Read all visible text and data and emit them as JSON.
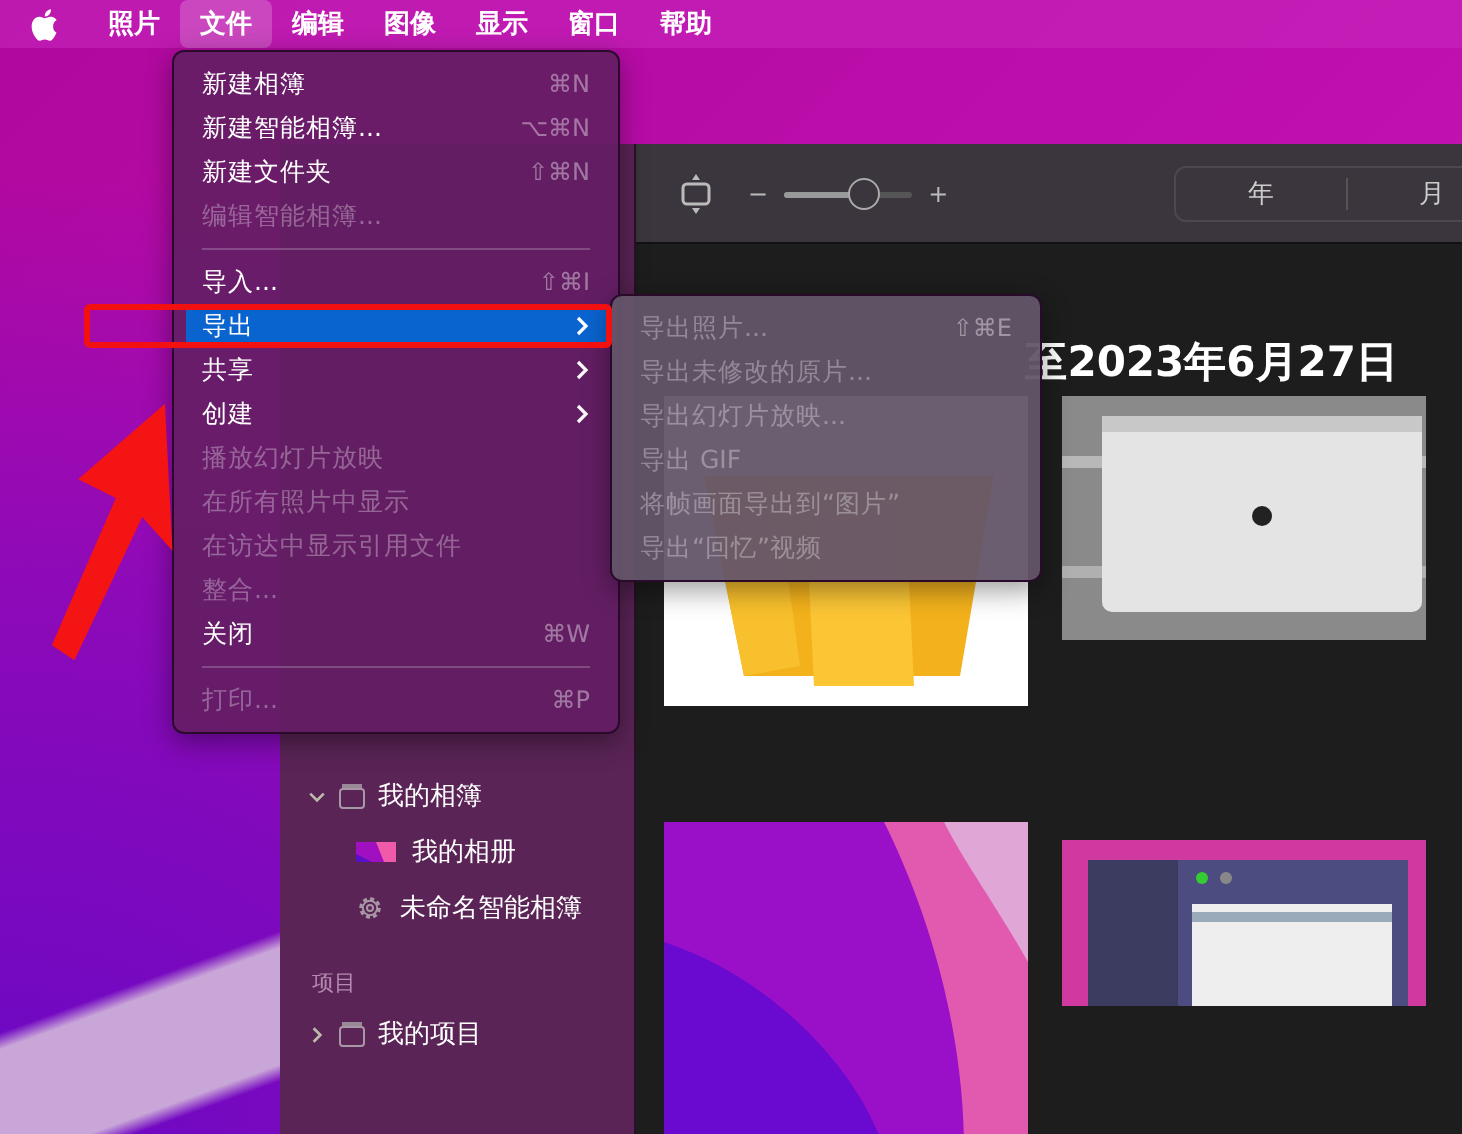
{
  "menu_bar": {
    "items": [
      {
        "label": "照片",
        "selected": false
      },
      {
        "label": "文件",
        "selected": true
      },
      {
        "label": "编辑",
        "selected": false
      },
      {
        "label": "图像",
        "selected": false
      },
      {
        "label": "显示",
        "selected": false
      },
      {
        "label": "窗口",
        "selected": false
      },
      {
        "label": "帮助",
        "selected": false
      }
    ]
  },
  "file_menu": {
    "items": [
      {
        "kind": "item",
        "label": "新建相簿",
        "shortcut": "⌘N",
        "disabled": false,
        "submenu": false,
        "selected": false
      },
      {
        "kind": "item",
        "label": "新建智能相簿...",
        "shortcut": "⌥⌘N",
        "disabled": false,
        "submenu": false,
        "selected": false
      },
      {
        "kind": "item",
        "label": "新建文件夹",
        "shortcut": "⇧⌘N",
        "disabled": false,
        "submenu": false,
        "selected": false
      },
      {
        "kind": "item",
        "label": "编辑智能相簿...",
        "disabled": true,
        "submenu": false,
        "selected": false
      },
      {
        "kind": "separator"
      },
      {
        "kind": "item",
        "label": "导入...",
        "shortcut": "⇧⌘I",
        "disabled": false,
        "submenu": false,
        "selected": false
      },
      {
        "kind": "item",
        "label": "导出",
        "disabled": false,
        "submenu": true,
        "selected": true
      },
      {
        "kind": "item",
        "label": "共享",
        "disabled": false,
        "submenu": true,
        "selected": false
      },
      {
        "kind": "item",
        "label": "创建",
        "disabled": false,
        "submenu": true,
        "selected": false
      },
      {
        "kind": "item",
        "label": "播放幻灯片放映",
        "disabled": true,
        "submenu": false,
        "selected": false
      },
      {
        "kind": "item",
        "label": "在所有照片中显示",
        "disabled": true,
        "submenu": false,
        "selected": false
      },
      {
        "kind": "item",
        "label": "在访达中显示引用文件",
        "disabled": true,
        "submenu": false,
        "selected": false
      },
      {
        "kind": "item",
        "label": "整合...",
        "disabled": true,
        "submenu": false,
        "selected": false
      },
      {
        "kind": "item",
        "label": "关闭",
        "shortcut": "⌘W",
        "disabled": false,
        "submenu": false,
        "selected": false
      },
      {
        "kind": "separator"
      },
      {
        "kind": "item",
        "label": "打印...",
        "shortcut": "⌘P",
        "disabled": true,
        "submenu": false,
        "selected": false
      }
    ]
  },
  "export_submenu": {
    "items": [
      {
        "label": "导出照片...",
        "shortcut": "⇧⌘E",
        "disabled": true
      },
      {
        "label": "导出未修改的原片...",
        "disabled": true
      },
      {
        "label": "导出幻灯片放映...",
        "disabled": true
      },
      {
        "label": "导出 GIF",
        "disabled": true
      },
      {
        "label": "将帧画面导出到“图片”",
        "disabled": true
      },
      {
        "label": "导出“回忆”视频",
        "disabled": true
      }
    ]
  },
  "sidebar": {
    "items": [
      {
        "kind": "folder",
        "label": "我的相簿",
        "expanded": true,
        "children": [
          {
            "kind": "album",
            "label": "我的相册"
          },
          {
            "kind": "smart",
            "label": "未命名智能相簿"
          }
        ]
      },
      {
        "kind": "header",
        "label": "项目"
      },
      {
        "kind": "folder",
        "label": "我的项目",
        "expanded": false
      }
    ]
  },
  "toolbar": {
    "zoom": {
      "minus": "−",
      "plus": "+",
      "level": 0.63
    },
    "segments": [
      {
        "label": "年"
      },
      {
        "label": "月"
      }
    ]
  },
  "content": {
    "date_heading": "至2023年6月27日"
  }
}
